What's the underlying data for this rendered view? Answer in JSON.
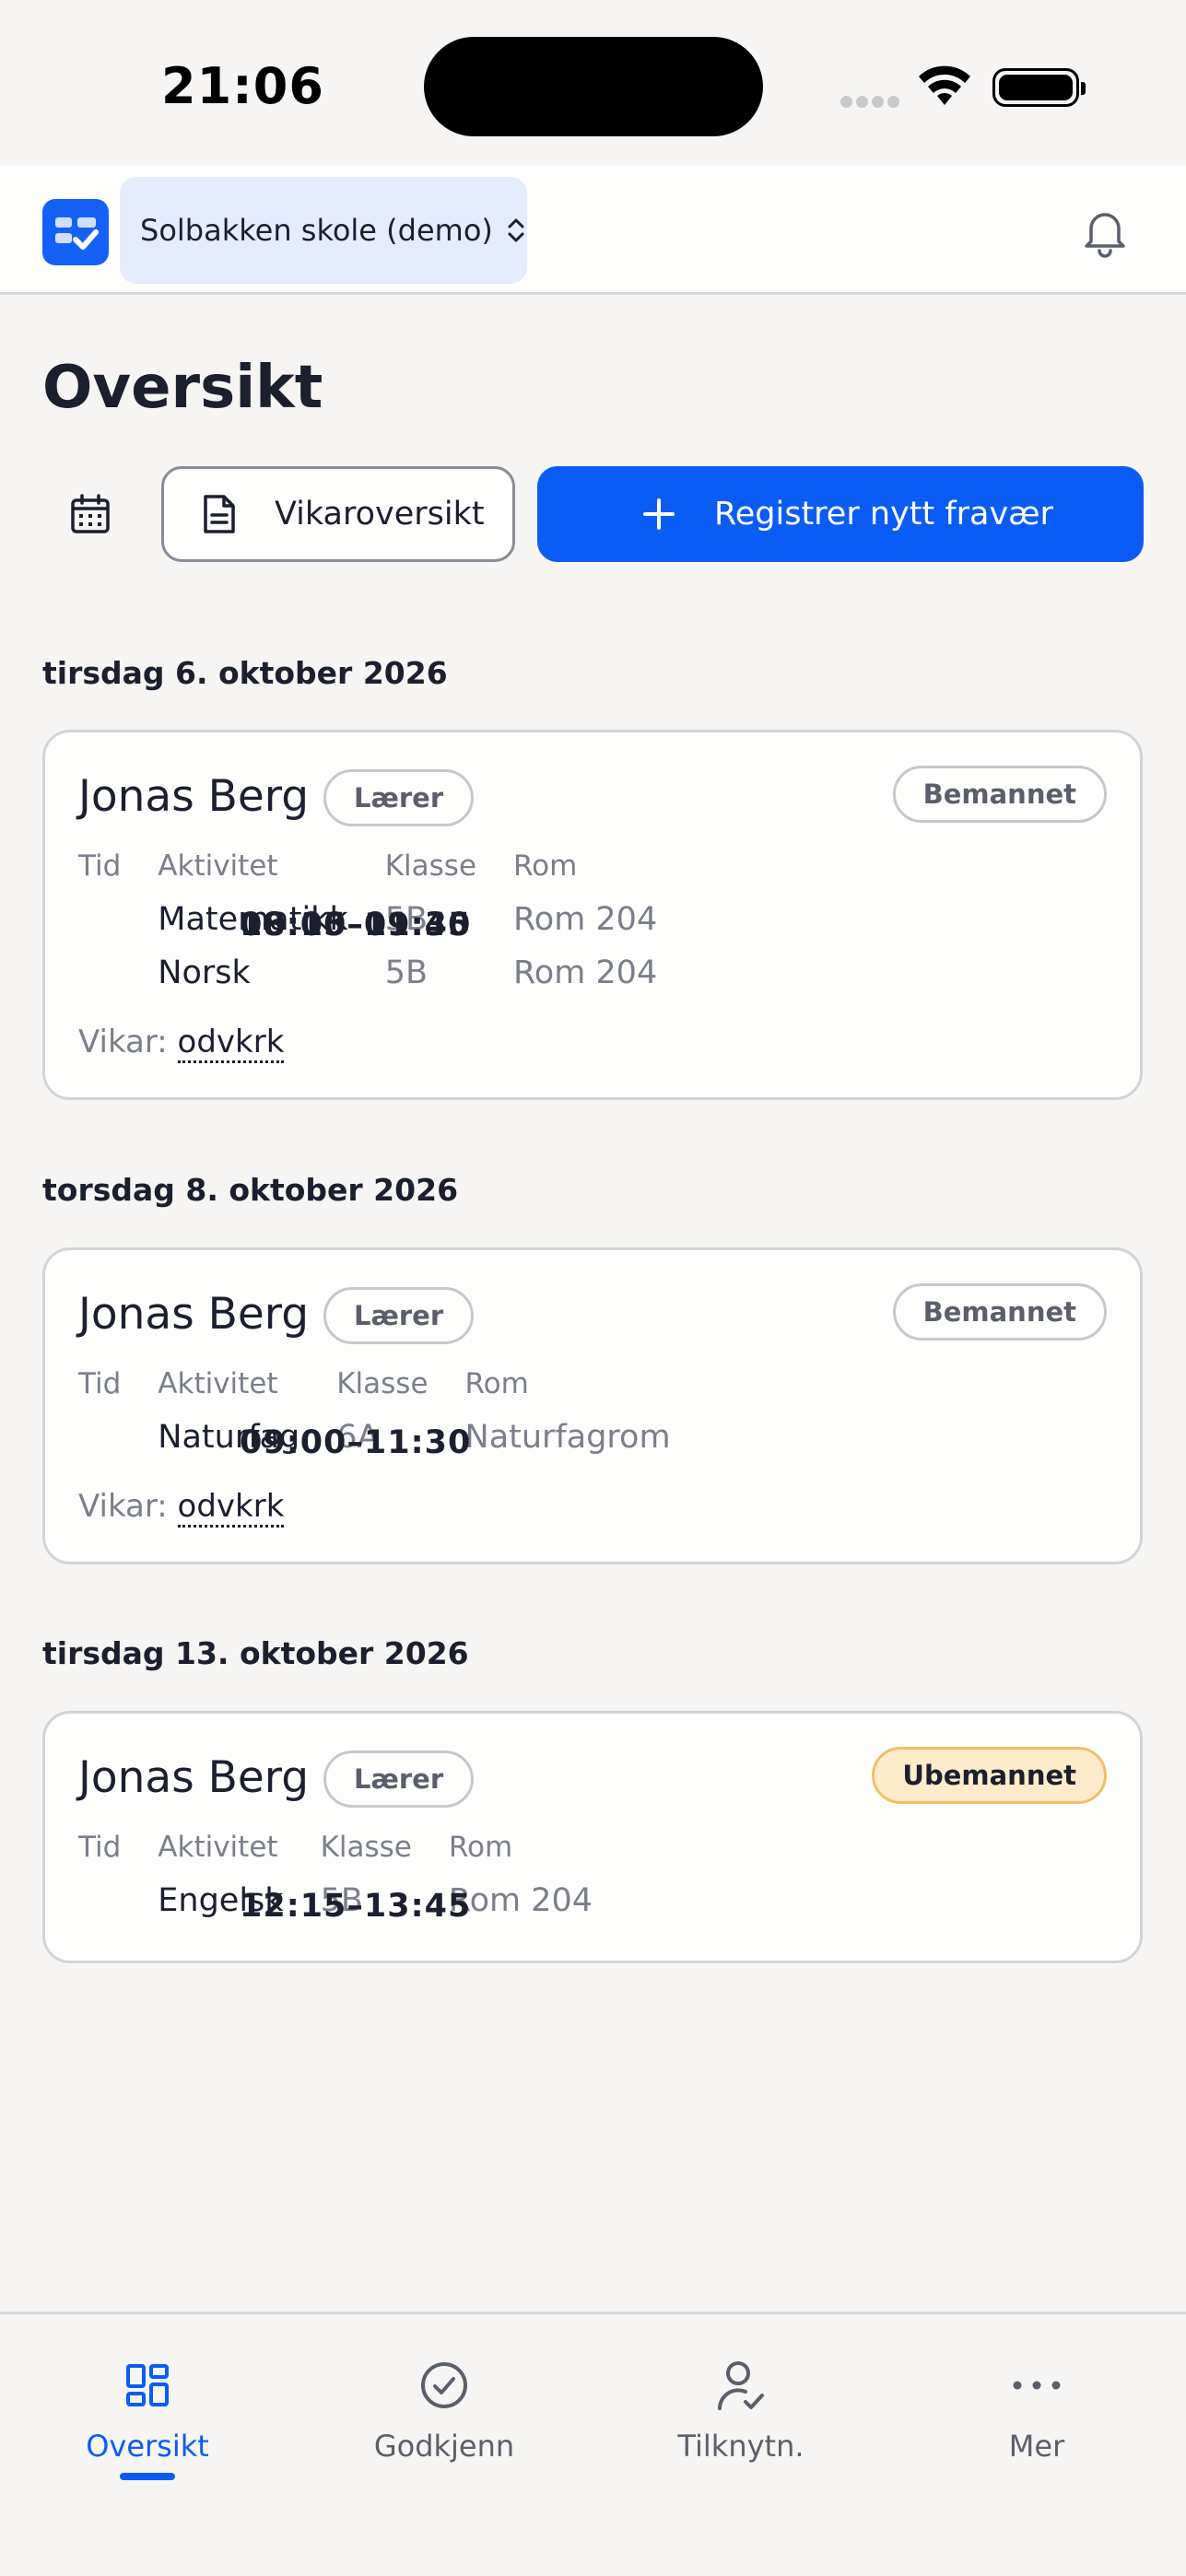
{
  "status_bar": {
    "time": "21:06"
  },
  "app_bar": {
    "school": "Solbakken skole (demo)"
  },
  "page": {
    "title": "Oversikt"
  },
  "actions": {
    "vikar_label": "Vikaroversikt",
    "register_label": "Registrer nytt fravær"
  },
  "columns": {
    "time": "Tid",
    "activity": "Aktivitet",
    "class": "Klasse",
    "room": "Rom"
  },
  "groups": [
    {
      "date": "tirsdag 6. oktober 2026",
      "name": "Jonas Berg",
      "role": "Lærer",
      "status": "Bemannet",
      "rows": [
        {
          "time": "08:15–09:45",
          "activity": "Matematikk",
          "class": "5B",
          "room": "Rom 204"
        },
        {
          "time": "10:00–11:30",
          "activity": "Norsk",
          "class": "5B",
          "room": "Rom 204"
        }
      ],
      "vikar_prefix": "Vikar:",
      "vikar_code": "odvkrk"
    },
    {
      "date": "torsdag 8. oktober 2026",
      "name": "Jonas Berg",
      "role": "Lærer",
      "status": "Bemannet",
      "rows": [
        {
          "time": "09:00–11:30",
          "activity": "Naturfag",
          "class": "6A",
          "room": "Naturfagrom"
        }
      ],
      "vikar_prefix": "Vikar:",
      "vikar_code": "odvkrk"
    },
    {
      "date": "tirsdag 13. oktober 2026",
      "name": "Jonas Berg",
      "role": "Lærer",
      "status": "Ubemannet",
      "rows": [
        {
          "time": "12:15–13:45",
          "activity": "Engelsk",
          "class": "5B",
          "room": "Rom 204"
        }
      ]
    }
  ],
  "tabs": [
    {
      "label": "Oversikt",
      "icon": "grid-icon",
      "active": true
    },
    {
      "label": "Godkjenn",
      "icon": "check-circle-icon",
      "active": false
    },
    {
      "label": "Tilknytn.",
      "icon": "user-check-icon",
      "active": false
    },
    {
      "label": "Mer",
      "icon": "more-icon",
      "active": false
    }
  ],
  "colors": {
    "primary": "#0b5cf5",
    "unstaffed_bg": "#fdebc9",
    "unstaffed_border": "#eec06b"
  }
}
